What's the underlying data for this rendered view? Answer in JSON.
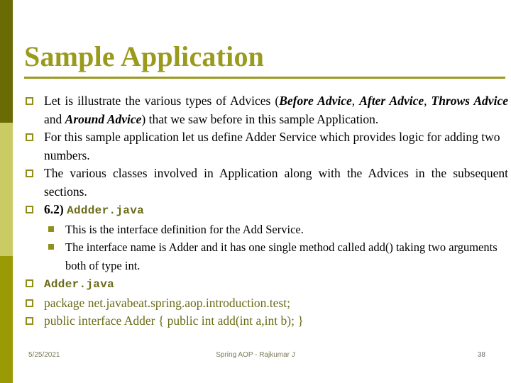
{
  "slide": {
    "title": "Sample Application",
    "accent_color": "#9a9a1e",
    "sidebar": {
      "band_top_color": "#6b6b05",
      "band_mid_color": "#cbcb66",
      "band_bottom_color": "#9a9a05"
    },
    "bullets": [
      {
        "marker": "hollow-square",
        "segments": [
          {
            "text": "Let  is  illustrate  the  various  types  of  Advices  (",
            "style": "plain"
          },
          {
            "text": "Before Advice",
            "style": "bold-italic"
          },
          {
            "text": ", ",
            "style": "plain"
          },
          {
            "text": "After Advice",
            "style": "bold-italic"
          },
          {
            "text": ", ",
            "style": "plain"
          },
          {
            "text": "Throws Advice",
            "style": "bold-italic"
          },
          {
            "text": "  and  ",
            "style": "plain"
          },
          {
            "text": "Around Advice",
            "style": "bold-italic"
          },
          {
            "text": ")  that  we  saw  before  in  this  sample Application.",
            "style": "plain"
          }
        ]
      },
      {
        "marker": "hollow-square",
        "segments": [
          {
            "text": "For this sample application let us define Adder Service which provides logic for adding two numbers.",
            "style": "plain"
          }
        ]
      },
      {
        "marker": "hollow-square",
        "segments": [
          {
            "text": "The  various  classes  involved  in  Application  along  with  the  Advices  in  the subsequent sections.",
            "style": "plain"
          }
        ]
      },
      {
        "marker": "hollow-square",
        "segments": [
          {
            "text": "6.2) ",
            "style": "bold"
          },
          {
            "text": "Addder.java",
            "style": "olive-mono"
          }
        ]
      }
    ],
    "sub_bullets": [
      {
        "marker": "solid-square",
        "text": "This is the interface definition for the Add Service."
      },
      {
        "marker": "solid-square",
        "text": "The interface name is Adder and it has one single method called add() taking two arguments both of type int."
      }
    ],
    "code_bullets": [
      {
        "marker": "hollow-square",
        "text": "Adder.java",
        "style": "olive-mono"
      },
      {
        "marker": "hollow-square",
        "text": "package net.javabeat.spring.aop.introduction.test;",
        "style": "olive"
      },
      {
        "marker": "hollow-square",
        "text": "public interface Adder { public int add(int a,int b); }",
        "style": "olive"
      }
    ]
  },
  "footer": {
    "date": "5/25/2021",
    "center": "Spring AOP  -  Rajkumar J",
    "page_number": "38"
  }
}
